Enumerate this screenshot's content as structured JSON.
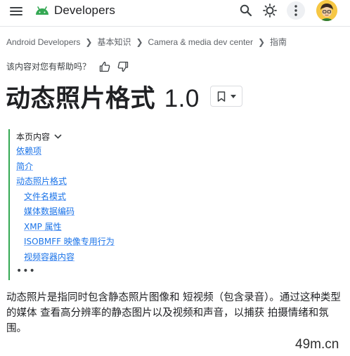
{
  "header": {
    "brand": "Developers",
    "brand_color": "#34a853",
    "icons": [
      "menu-icon",
      "android-logo-icon",
      "search-icon",
      "theme-brightness-icon",
      "more-vert-icon",
      "avatar"
    ]
  },
  "breadcrumb": [
    "Android Developers",
    "基本知识",
    "Camera & media dev center",
    "指南"
  ],
  "feedback": {
    "question": "该内容对您有帮助吗？"
  },
  "page": {
    "title_cn": "动态照片格式",
    "title_ver": "1.0"
  },
  "toc": {
    "heading": "本页内容",
    "items": [
      {
        "label": "依赖项",
        "level": 1
      },
      {
        "label": "简介",
        "level": 1
      },
      {
        "label": "动态照片格式",
        "level": 1
      },
      {
        "label": "文件名模式",
        "level": 2
      },
      {
        "label": "媒体数据编码",
        "level": 2
      },
      {
        "label": "XMP 属性",
        "level": 2
      },
      {
        "label": "ISOBMFF 映像专用行为",
        "level": 2
      },
      {
        "label": "视频容器内容",
        "level": 2
      }
    ],
    "more": "•••",
    "accent": "#34a853",
    "link_color": "#1a73e8"
  },
  "body": {
    "paragraph": "动态照片是指同时包含静态照片图像和 短视频（包含录音）。通过这种类型的媒体 查看高分辨率的静态图片以及视频和声音，以捕获 拍摄情绪和氛围。"
  },
  "watermark": "49m.cn"
}
